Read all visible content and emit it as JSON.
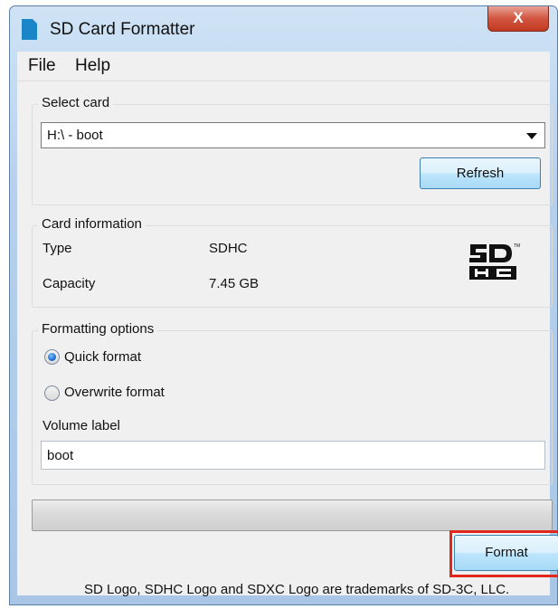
{
  "window": {
    "title": "SD Card Formatter",
    "close_label": "X"
  },
  "menu": {
    "file": "File",
    "help": "Help"
  },
  "select_card": {
    "label": "Select card",
    "selected": "H:\\ - boot",
    "refresh_label": "Refresh"
  },
  "card_info": {
    "label": "Card information",
    "type_label": "Type",
    "type_value": "SDHC",
    "capacity_label": "Capacity",
    "capacity_value": "7.45 GB",
    "logo_text": "SDHC"
  },
  "formatting": {
    "label": "Formatting options",
    "quick_label": "Quick format",
    "quick_selected": true,
    "overwrite_label": "Overwrite format",
    "overwrite_selected": false,
    "volume_label": "Volume label",
    "volume_value": "boot"
  },
  "progress": {
    "value": 0
  },
  "format_button": {
    "label": "Format"
  },
  "footer": {
    "text": "SD Logo, SDHC Logo and SDXC Logo are trademarks of SD-3C, LLC."
  },
  "colors": {
    "highlight": "#e3261b",
    "accent": "#1a86c8"
  }
}
